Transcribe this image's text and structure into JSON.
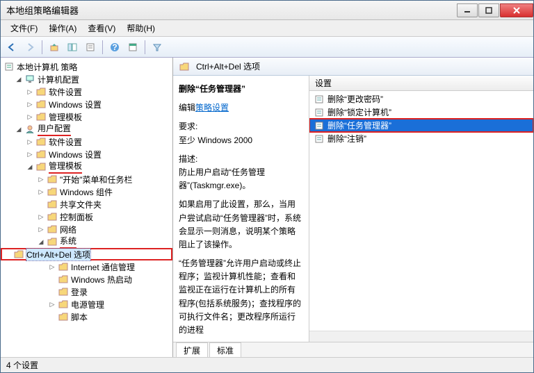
{
  "window": {
    "title": "本地组策略编辑器"
  },
  "menus": {
    "file": "文件(F)",
    "action": "操作(A)",
    "view": "查看(V)",
    "help": "帮助(H)"
  },
  "tree": {
    "root": "本地计算机 策略",
    "computer_config": "计算机配置",
    "user_config": "用户配置",
    "software_settings": "软件设置",
    "windows_settings": "Windows 设置",
    "admin_templates": "管理模板",
    "start_menu": "\"开始\"菜单和任务栏",
    "windows_components": "Windows 组件",
    "shared_folders": "共享文件夹",
    "control_panel": "控制面板",
    "network": "网络",
    "system": "系统",
    "ctrl_alt_del": "Ctrl+Alt+Del 选项",
    "internet_comm": "Internet 通信管理",
    "windows_hot_boot": "Windows 热启动",
    "logon": "登录",
    "power_options": "电源管理",
    "scripts": "脚本"
  },
  "header": {
    "path": "Ctrl+Alt+Del 选项"
  },
  "desc": {
    "title": "删除“任务管理器”",
    "edit_label": "编辑",
    "edit_link": "策略设置",
    "req_label": "要求:",
    "req_value": "至少 Windows 2000",
    "body_label": "描述:",
    "p1": "防止用户启动“任务管理器”(Taskmgr.exe)。",
    "p2": "如果启用了此设置，那么，当用户尝试启动“任务管理器”时，系统会显示一则消息，说明某个策略阻止了该操作。",
    "p3": "“任务管理器”允许用户启动或终止程序；监视计算机性能；查看和监视正在运行在计算机上的所有程序(包括系统服务)；查找程序的可执行文件名；更改程序所运行的进程"
  },
  "list": {
    "col_setting": "设置",
    "items": [
      {
        "label": "删除“更改密码”",
        "selected": false
      },
      {
        "label": "删除“锁定计算机”",
        "selected": false
      },
      {
        "label": "删除“任务管理器”",
        "selected": true
      },
      {
        "label": "删除“注销”",
        "selected": false
      }
    ]
  },
  "tabs": {
    "extended": "扩展",
    "standard": "标准"
  },
  "status": {
    "text": "4 个设置"
  }
}
